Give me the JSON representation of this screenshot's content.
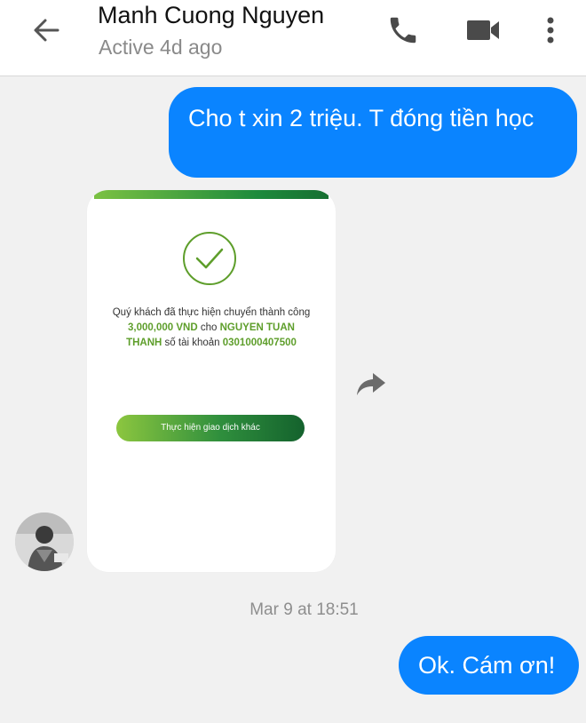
{
  "header": {
    "contact_name": "Manh Cuong Nguyen",
    "status": "Active 4d ago"
  },
  "icons": {
    "back": "arrow-left-icon",
    "call": "phone-icon",
    "video": "video-camera-icon",
    "more": "more-vertical-icon",
    "forward": "forward-arrow-icon",
    "check": "check-circle-icon"
  },
  "colors": {
    "outgoing_bubble": "#0a84ff",
    "bank_green": "#5e9e2b",
    "bank_dark_green": "#14622d"
  },
  "messages": {
    "outgoing_1": "Cho t xin  2 triệu. T đóng tiền học",
    "outgoing_2": "Ok. Cám ơn!"
  },
  "receipt": {
    "line1": "Quý khách đã thực hiện chuyển thành công",
    "amount": "3,000,000 VND",
    "to_word": " cho ",
    "recipient_part1": "NGUYEN TUAN",
    "recipient_part2": "THANH",
    "account_label": " số tài khoản ",
    "account_number": "0301000407500",
    "button_label": "Thực hiện giao dịch khác"
  },
  "timestamp": "Mar 9 at 18:51"
}
